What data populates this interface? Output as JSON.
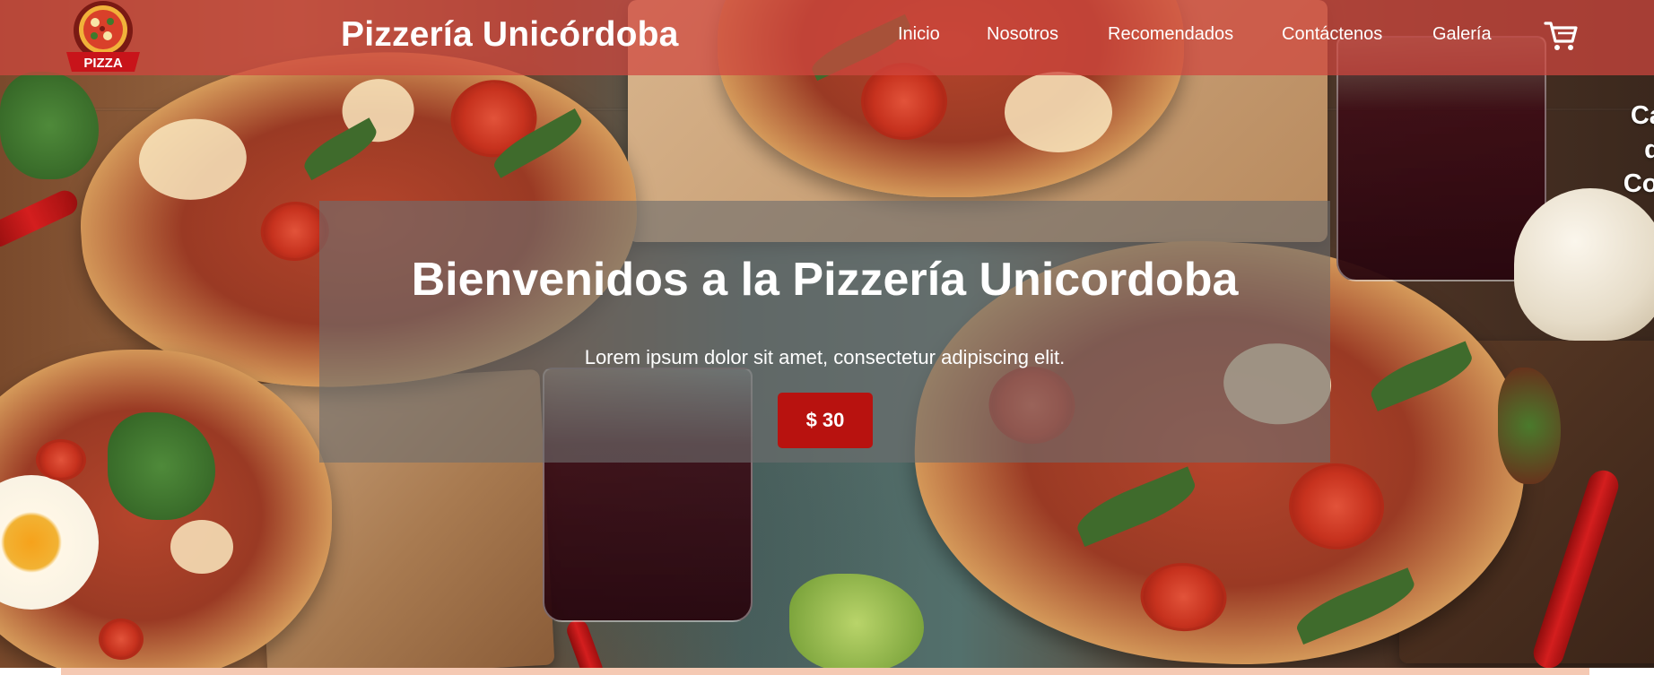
{
  "header": {
    "brand": "Pizzería Unicórdoba",
    "logo_text": "PIZZA",
    "nav": [
      {
        "label": "Inicio"
      },
      {
        "label": "Nosotros"
      },
      {
        "label": "Recomendados"
      },
      {
        "label": "Contáctenos"
      },
      {
        "label": "Galería"
      }
    ],
    "cart_icon": "shopping-cart-icon"
  },
  "side_text": {
    "line1": "Car",
    "line2": "d",
    "line3": "Com"
  },
  "hero": {
    "title": "Bienvenidos a la Pizzería Unicordoba",
    "subtitle": "Lorem ipsum dolor sit amet, consectetur adipiscing elit.",
    "price_button": "$ 30"
  },
  "colors": {
    "navbar": "#d0463e",
    "button": "#b8120f",
    "card": "#6e6e6e",
    "strip": "#f5c9b3"
  }
}
